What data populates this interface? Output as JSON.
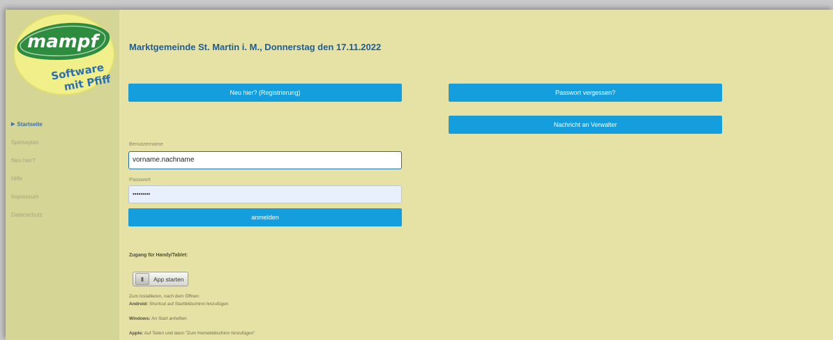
{
  "logo": {
    "brand": "mampf",
    "tagline_1": "Software",
    "tagline_2": "mit Pfiff"
  },
  "sidebar": {
    "items": [
      {
        "label": "Startseite",
        "active": true
      },
      {
        "label": "Speiseplan"
      },
      {
        "label": "Neu hier?"
      },
      {
        "label": "Hilfe"
      },
      {
        "label": "Impressum"
      },
      {
        "label": "Datenschutz"
      }
    ]
  },
  "header": {
    "title": "Marktgemeinde St. Martin i. M., Donnerstag den 17.11.2022"
  },
  "buttons": {
    "register": "Neu hier? (Registrierung)",
    "forgot": "Passwort vergessen?",
    "message": "Nachricht an Verwalter",
    "login": "anmelden"
  },
  "form": {
    "username_label": "Benutzername",
    "username_value": "vorname.nachname",
    "password_label": "Passwort",
    "password_value": "•••••••••"
  },
  "mobile": {
    "heading": "Zugang für Handy/Tablet:",
    "app_button": "App starten",
    "install_note": "Zum Installieren, nach dem Öffnen:",
    "android_label": "Android:",
    "android_text": "Shortcut auf Startbildschirm hinzufügen",
    "windows_label": "Windows:",
    "windows_text": "An Start anheften",
    "apple_label": "Apple:",
    "apple_text": "Auf Teilen und dann \"Zum Homebildschirm hinzufügen\""
  },
  "colors": {
    "accent": "#159ede",
    "background": "#e6e2a6",
    "sidebar": "#d5d596",
    "title": "#1c5d97"
  }
}
